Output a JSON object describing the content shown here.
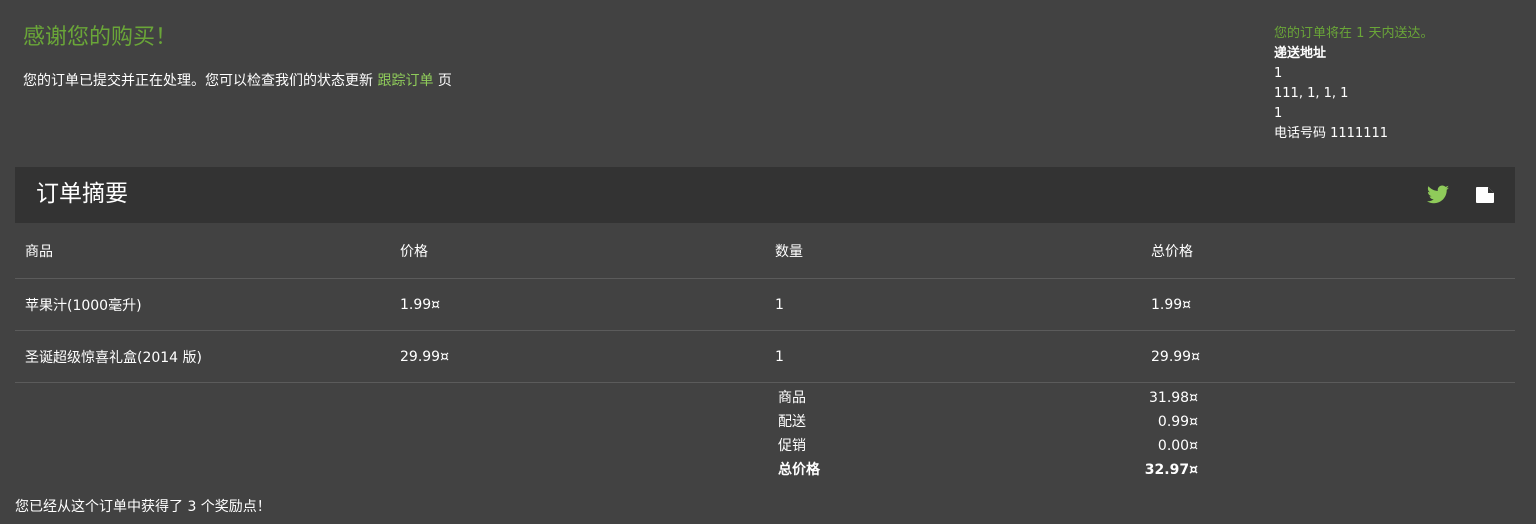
{
  "header": {
    "thanks": "感谢您的购买！",
    "submitted_prefix": "您的订单已提交并正在处理。您可以检查我们的状态更新",
    "track_link": "跟踪订单",
    "submitted_suffix": "页"
  },
  "delivery": {
    "eta": "您的订单将在 1 天内送达。",
    "address_title": "递送地址",
    "lines": [
      "1",
      "111, 1, 1, 1",
      "1",
      "电话号码 1111111"
    ]
  },
  "summary": {
    "title": "订单摘要",
    "icons": [
      "twitter-icon",
      "tag-icon"
    ]
  },
  "table": {
    "headers": [
      "商品",
      "价格",
      "数量",
      "总价格"
    ],
    "rows": [
      [
        "苹果汁(1000毫升)",
        "1.99¤",
        "1",
        "1.99¤"
      ],
      [
        "圣诞超级惊喜礼盒(2014 版)",
        "29.99¤",
        "1",
        "29.99¤"
      ]
    ]
  },
  "totals": {
    "items_label": "商品",
    "items_value": "31.98¤",
    "shipping_label": "配送",
    "shipping_value": "0.99¤",
    "promo_label": "促销",
    "promo_value": "0.00¤",
    "total_label": "总价格",
    "total_value": "32.97¤"
  },
  "footer": {
    "points": "您已经从这个订单中获得了 3 个奖励点！"
  },
  "colors": {
    "background": "#424242",
    "bar": "#333333",
    "accent_green": "#6aa638",
    "link_green": "#8fcb5a"
  }
}
